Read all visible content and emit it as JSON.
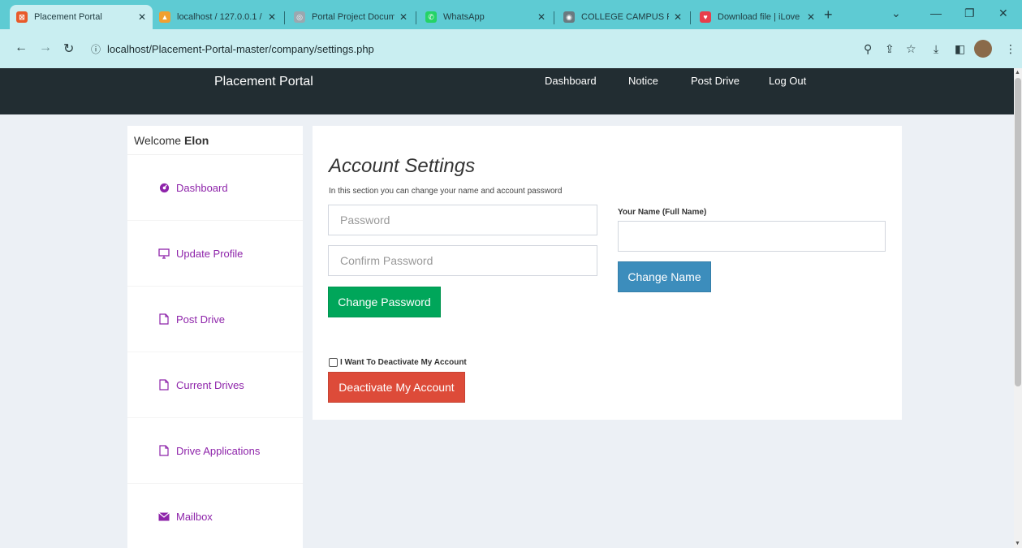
{
  "browser": {
    "tabs": [
      {
        "label": "Placement Portal",
        "fav_color": "#e85a2a",
        "fav_glyph": "⊠"
      },
      {
        "label": "localhost / 127.0.0.1 /",
        "fav_color": "#f0a030",
        "fav_glyph": "▲"
      },
      {
        "label": "Portal Project Docum",
        "fav_color": "#9aa8b0",
        "fav_glyph": "◎"
      },
      {
        "label": "WhatsApp",
        "fav_color": "#25d366",
        "fav_glyph": "✆"
      },
      {
        "label": "COLLEGE CAMPUS RE",
        "fav_color": "#6a7a80",
        "fav_glyph": "◉"
      },
      {
        "label": "Download file | iLove",
        "fav_color": "#e83e4c",
        "fav_glyph": "♥"
      }
    ],
    "url": "localhost/Placement-Portal-master/company/settings.php"
  },
  "nav": {
    "brand": "Placement Portal",
    "links": [
      "Dashboard",
      "Notice",
      "Post Drive",
      "Log Out"
    ]
  },
  "sidebar": {
    "welcome_prefix": "Welcome",
    "user": "Elon",
    "items": [
      {
        "label": "Dashboard",
        "icon": "dashboard-icon"
      },
      {
        "label": "Update Profile",
        "icon": "monitor-icon"
      },
      {
        "label": "Post Drive",
        "icon": "file-icon"
      },
      {
        "label": "Current Drives",
        "icon": "file-icon"
      },
      {
        "label": "Drive Applications",
        "icon": "file-icon"
      },
      {
        "label": "Mailbox",
        "icon": "envelope-icon"
      }
    ]
  },
  "settings": {
    "title": "Account Settings",
    "subtitle": "In this section you can change your name and account password",
    "password_placeholder": "Password",
    "confirm_placeholder": "Confirm Password",
    "change_password_label": "Change Password",
    "name_label": "Your Name (Full Name)",
    "change_name_label": "Change Name",
    "deactivate_check_label": "I Want To Deactivate My Account",
    "deactivate_button_label": "Deactivate My Account"
  },
  "colors": {
    "accent": "#8e24aa",
    "green": "#00a65a",
    "blue": "#3c8dbc",
    "red": "#dd4b39",
    "navbar": "#222d32"
  }
}
